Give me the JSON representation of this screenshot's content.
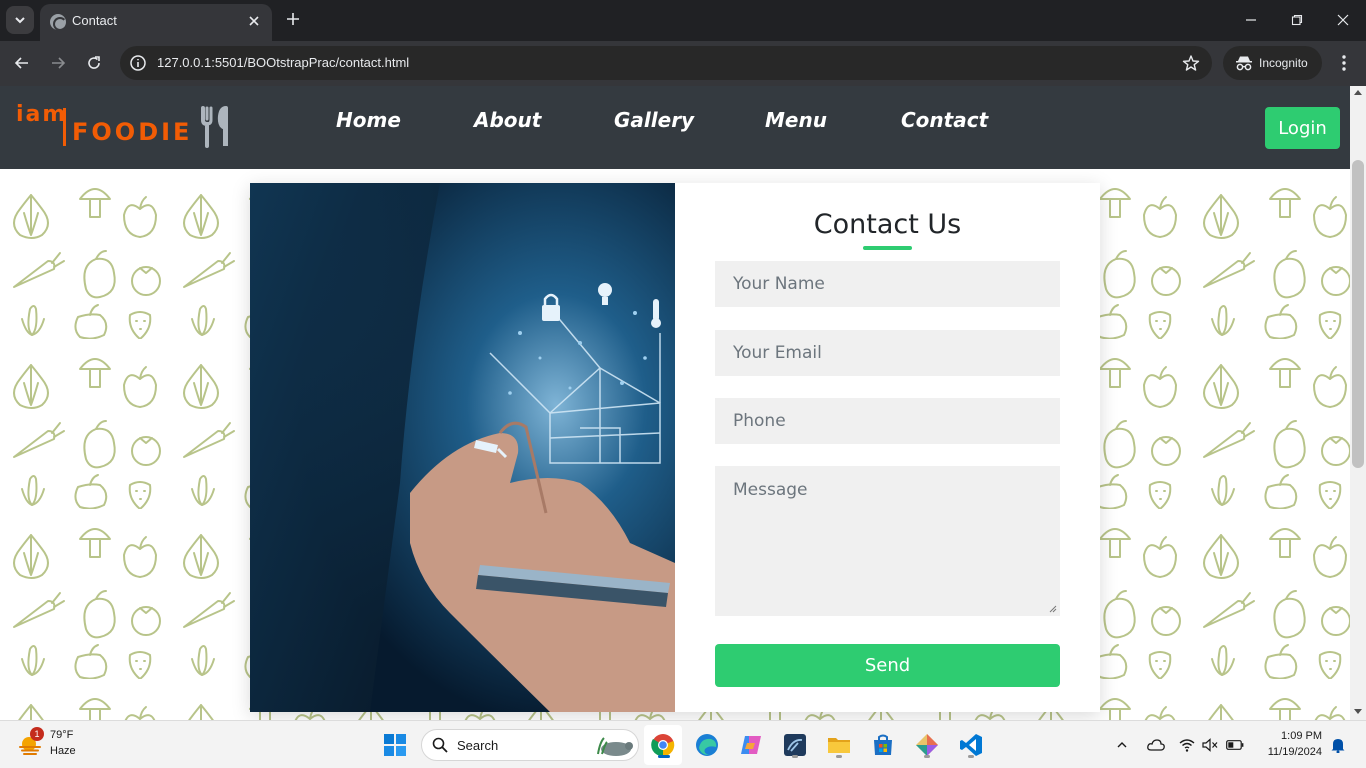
{
  "browser": {
    "tab_title": "Contact",
    "url": "127.0.0.1:5501/BOOtstrapPrac/contact.html",
    "incognito_label": "Incognito",
    "icons": [
      "tab-search-icon",
      "close-icon",
      "plus-icon",
      "minimize-icon",
      "restore-icon",
      "close-window-icon",
      "back-icon",
      "forward-icon",
      "reload-icon",
      "site-info-icon",
      "star-icon",
      "incognito-icon",
      "kebab-menu-icon"
    ]
  },
  "navbar": {
    "logo": {
      "prefix": "iam",
      "brand": "FOODIE"
    },
    "links": [
      "Home",
      "About",
      "Gallery",
      "Menu",
      "Contact"
    ],
    "login_label": "Login"
  },
  "contact": {
    "title": "Contact Us",
    "name_placeholder": "Your Name",
    "email_placeholder": "Your Email",
    "phone_placeholder": "Phone",
    "message_placeholder": "Message",
    "send_label": "Send"
  },
  "colors": {
    "accent_green": "#2ecc71",
    "brand_orange": "#f25c05",
    "navbar_bg": "#343a40",
    "pattern_green": "#b8c48a"
  },
  "taskbar": {
    "weather": {
      "temp": "79°F",
      "condition": "Haze",
      "badge": "1"
    },
    "search_label": "Search",
    "clock": {
      "time": "1:09 PM",
      "date": "11/19/2024"
    },
    "apps": [
      "windows-start-icon",
      "chrome-icon",
      "edge-icon",
      "copilot-icon",
      "mysql-workbench-icon",
      "file-explorer-icon",
      "microsoft-store-icon",
      "git-icon",
      "vscode-icon"
    ],
    "tray": [
      "chevron-up-icon",
      "onedrive-cloud-icon",
      "wifi-icon",
      "speaker-muted-icon",
      "battery-icon",
      "notification-bell-icon"
    ]
  }
}
